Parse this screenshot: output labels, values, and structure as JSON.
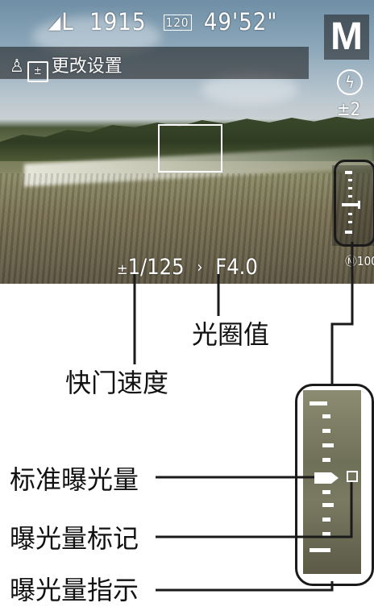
{
  "screen": {
    "top_info": {
      "quality": "L",
      "shots_remaining": "1915",
      "movie_quality": "120",
      "recording_time": "49'52\""
    },
    "mode_badge": "M",
    "mode_label": "更改设置",
    "flash_comp_text": "±2",
    "shutter_speed": "1/125",
    "aperture": "F4.0",
    "corner_value": "Ⓜ100"
  },
  "callouts": {
    "aperture": "光圈值",
    "shutter_speed": "快门速度",
    "standard_exposure": "标准曝光量",
    "exposure_mark": "曝光量标记",
    "exposure_indicator": "曝光量指示"
  }
}
